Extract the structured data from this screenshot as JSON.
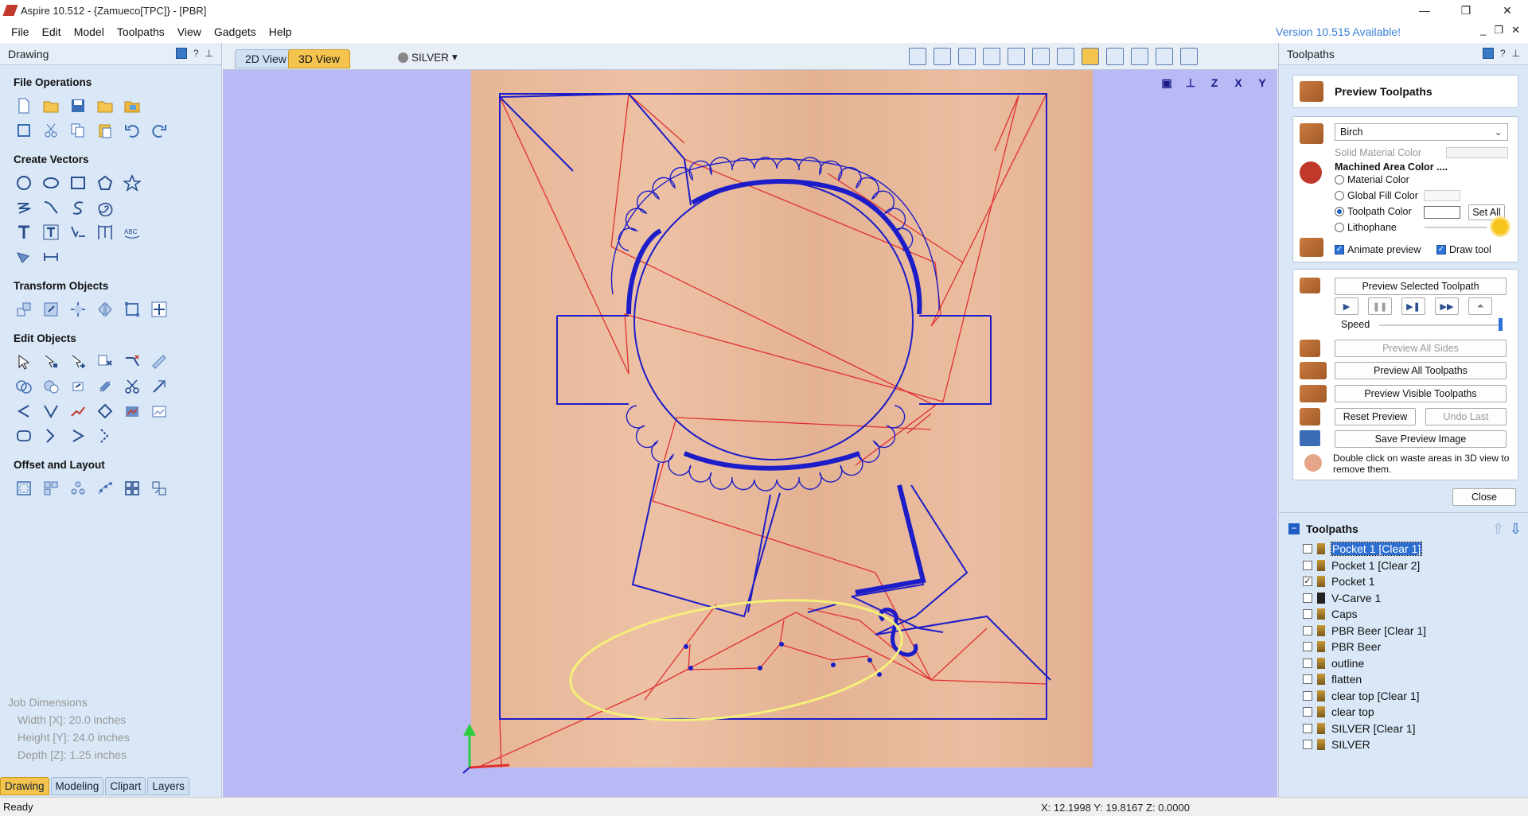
{
  "window": {
    "title": "Aspire 10.512 - {Zamueco[TPC]} - [PBR]",
    "controls": [
      "—",
      "❐",
      "✕"
    ]
  },
  "menu": {
    "items": [
      "File",
      "Edit",
      "Model",
      "Toolpaths",
      "View",
      "Gadgets",
      "Help"
    ],
    "update_notice": "Version 10.515 Available!"
  },
  "left_panel": {
    "title": "Drawing",
    "sections": {
      "file_ops": "File Operations",
      "create_vectors": "Create Vectors",
      "transform": "Transform Objects",
      "edit": "Edit Objects",
      "offset": "Offset and Layout"
    },
    "job_dimensions": {
      "title": "Job Dimensions",
      "width": "Width  [X]: 20.0 inches",
      "height": "Height [Y]: 24.0 inches",
      "depth": "Depth  [Z]: 1.25 inches"
    },
    "bottom_tabs": [
      "Drawing",
      "Modeling",
      "Clipart",
      "Layers"
    ]
  },
  "view": {
    "tab_2d": "2D View",
    "tab_3d": "3D View",
    "material_dropdown": "SILVER"
  },
  "right_panel": {
    "title": "Toolpaths",
    "preview_title": "Preview Toolpaths",
    "material": "Birch",
    "solid_material_color": "Solid Material Color",
    "machined_area_color": "Machined Area Color ....",
    "radio_options": [
      "Material Color",
      "Global Fill Color",
      "Toolpath Color",
      "Lithophane"
    ],
    "radio_selected": "Toolpath Color",
    "set_all": "Set All",
    "animate_preview": "Animate preview",
    "draw_tool": "Draw tool",
    "preview_selected": "Preview Selected Toolpath",
    "speed": "Speed",
    "preview_all_sides": "Preview All Sides",
    "preview_all_toolpaths": "Preview All Toolpaths",
    "preview_visible": "Preview Visible Toolpaths",
    "reset_preview": "Reset Preview",
    "undo_last": "Undo Last",
    "save_preview_image": "Save Preview Image",
    "hint": "Double click on waste areas in 3D view to remove them.",
    "close": "Close",
    "toolpaths_list_title": "Toolpaths",
    "toolpaths": [
      {
        "name": "Pocket 1 [Clear 1]",
        "checked": false,
        "selected": true
      },
      {
        "name": "Pocket 1 [Clear 2]",
        "checked": false,
        "selected": false
      },
      {
        "name": "Pocket 1",
        "checked": true,
        "selected": false
      },
      {
        "name": "V-Carve 1",
        "checked": false,
        "selected": false
      },
      {
        "name": "Caps",
        "checked": false,
        "selected": false
      },
      {
        "name": "PBR Beer [Clear 1]",
        "checked": false,
        "selected": false
      },
      {
        "name": "PBR Beer",
        "checked": false,
        "selected": false
      },
      {
        "name": "outline",
        "checked": false,
        "selected": false
      },
      {
        "name": "flatten",
        "checked": false,
        "selected": false
      },
      {
        "name": "clear top [Clear 1]",
        "checked": false,
        "selected": false
      },
      {
        "name": "clear top",
        "checked": false,
        "selected": false
      },
      {
        "name": "SILVER [Clear 1]",
        "checked": false,
        "selected": false
      },
      {
        "name": "SILVER",
        "checked": false,
        "selected": false
      }
    ]
  },
  "status": {
    "text": "Ready",
    "coords": "X: 12.1998 Y: 19.8167 Z:  0.0000"
  },
  "colors": {
    "accent_tab": "#f4c44e",
    "panel_bg": "#d9e7f6",
    "viewport_bg": "#b9b9f5",
    "vector_blue": "#1c1cc8",
    "toolpath_red": "#e03030",
    "highlight_yellow": "#f5f07a",
    "update_link": "#3b7fd6"
  }
}
